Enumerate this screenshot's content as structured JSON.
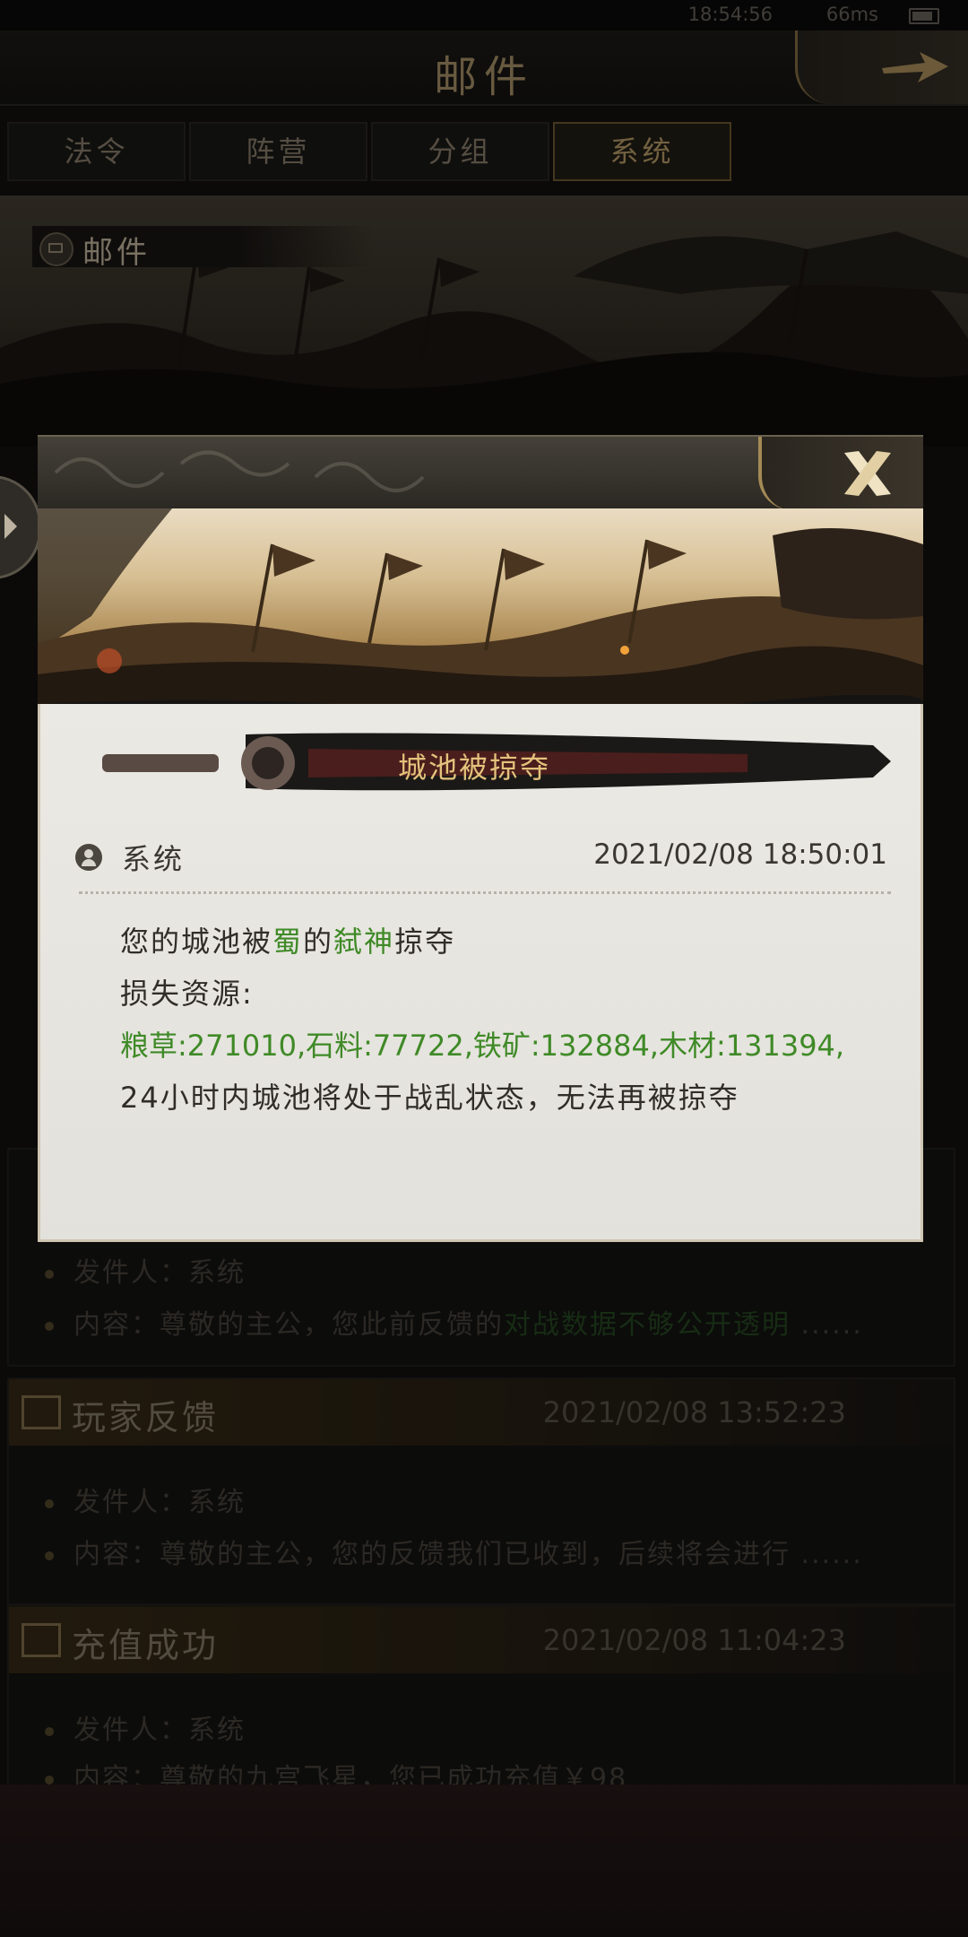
{
  "status_bar": {
    "time": "18:54:56",
    "network": "66ms"
  },
  "header": {
    "title": "邮件"
  },
  "tabs": [
    {
      "label": "法令"
    },
    {
      "label": "阵营"
    },
    {
      "label": "分组"
    },
    {
      "label": "系统",
      "active": true
    }
  ],
  "banner": {
    "label": "邮件"
  },
  "mail_list": [
    {
      "subject": "",
      "time": "",
      "sender_label": "发件人：",
      "sender": "系统",
      "content_label": "内容：",
      "preview_prefix": "尊敬的主公，您此前反馈的",
      "preview_highlight": "对战数据不够公开透明",
      "preview_suffix": "......"
    },
    {
      "subject": "玩家反馈",
      "time": "2021/02/08 13:52:23",
      "sender_label": "发件人：",
      "sender": "系统",
      "content_label": "内容：",
      "preview": "尊敬的主公，您的反馈我们已收到，后续将会进行 ......"
    },
    {
      "subject": "充值成功",
      "time": "2021/02/08 11:04:23",
      "sender_label": "发件人：",
      "sender": "系统",
      "content_label": "内容：",
      "preview": "尊敬的九宫飞星，您已成功充值￥98"
    }
  ],
  "modal": {
    "title": "城池被掠夺",
    "sender": "系统",
    "date": "2021/02/08 18:50:01",
    "line1": {
      "prefix": "您的城池被",
      "faction": "蜀",
      "mid": "的",
      "player": "弑神",
      "suffix": "掠夺"
    },
    "line2": "损失资源:",
    "line3": "粮草:271010,石料:77722,铁矿:132884,木材:131394,",
    "line4": "24小时内城池将处于战乱状态，无法再被掠夺"
  },
  "colors": {
    "accent_gold": "#c4a86f",
    "highlight_green": "#3f8a27",
    "modal_bg": "#e8e6e1"
  }
}
